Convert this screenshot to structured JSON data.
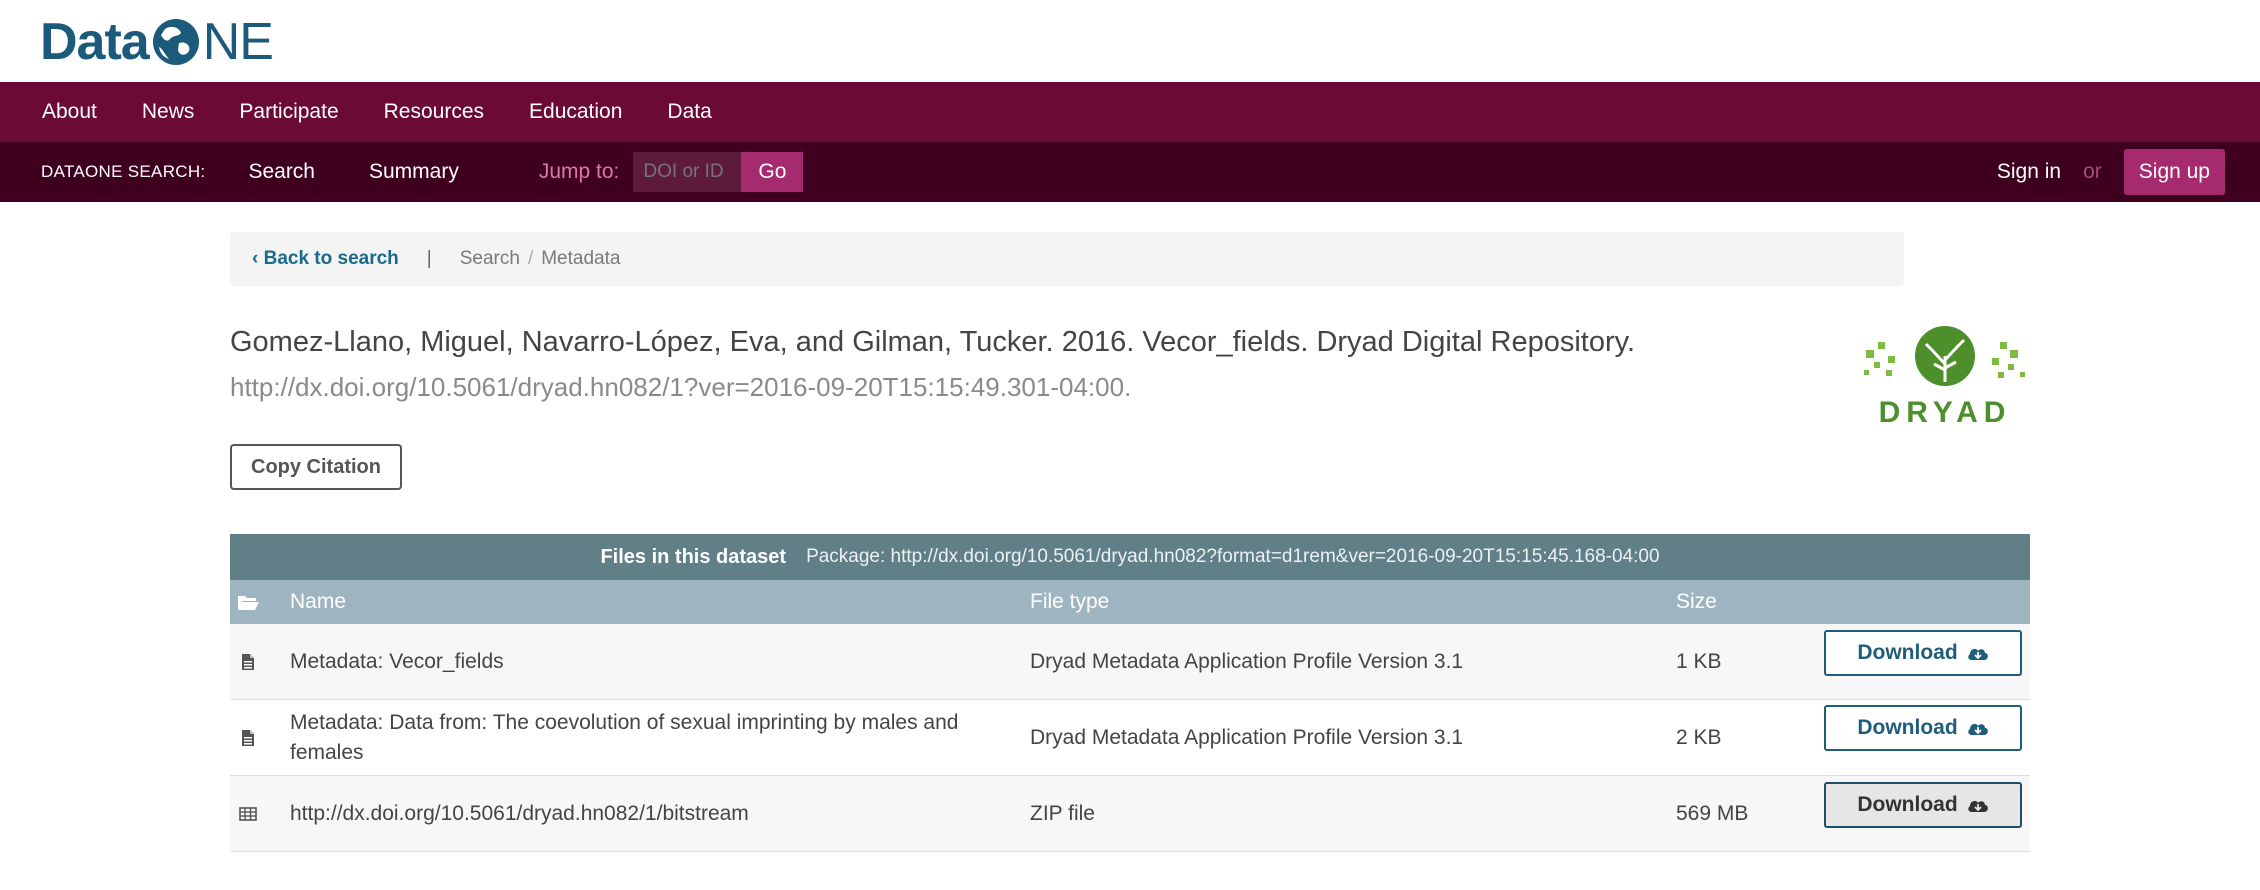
{
  "logo": {
    "text_left": "Data",
    "text_right": "NE"
  },
  "main_nav": {
    "items": [
      "About",
      "News",
      "Participate",
      "Resources",
      "Education",
      "Data"
    ]
  },
  "search_nav": {
    "label": "DATAONE SEARCH:",
    "tabs": [
      "Search",
      "Summary"
    ],
    "jump_label": "Jump to:",
    "jump_placeholder": "DOI or ID",
    "go_label": "Go",
    "signin_label": "Sign in",
    "or_label": "or",
    "signup_label": "Sign up"
  },
  "breadcrumb": {
    "back_label": "‹ Back to search",
    "separator": "|",
    "crumbs": [
      "Search",
      "Metadata"
    ],
    "slash": "/"
  },
  "citation": {
    "text": "Gomez-Llano, Miguel, Navarro-López, Eva, and Gilman, Tucker. 2016. Vecor_fields. Dryad Digital Repository.",
    "link": "http://dx.doi.org/10.5061/dryad.hn082/1?ver=2016-09-20T15:15:49.301-04:00.",
    "copy_label": "Copy Citation"
  },
  "repository_logo": {
    "text": "DRYAD",
    "color": "#4d8f2b"
  },
  "files": {
    "title": "Files in this dataset",
    "package": "Package: http://dx.doi.org/10.5061/dryad.hn082?format=d1rem&ver=2016-09-20T15:15:45.168-04:00",
    "columns": {
      "name": "Name",
      "type": "File type",
      "size": "Size"
    },
    "rows": [
      {
        "name": "Metadata: Vecor_fields",
        "type": "Dryad Metadata Application Profile Version 3.1",
        "size": "1 KB",
        "download": "Download",
        "icon": "document-icon"
      },
      {
        "name": "Metadata: Data from: The coevolution of sexual imprinting by males and females",
        "type": "Dryad Metadata Application Profile Version 3.1",
        "size": "2 KB",
        "download": "Download",
        "icon": "document-icon"
      },
      {
        "name": "http://dx.doi.org/10.5061/dryad.hn082/1/bitstream",
        "type": "ZIP file",
        "size": "569 MB",
        "download": "Download",
        "icon": "table-icon"
      }
    ]
  },
  "colors": {
    "nav_primary": "#6a0a35",
    "nav_secondary": "#3f0020",
    "accent": "#a62a6e",
    "table_header": "#607f87",
    "link": "#1a6a8a"
  }
}
